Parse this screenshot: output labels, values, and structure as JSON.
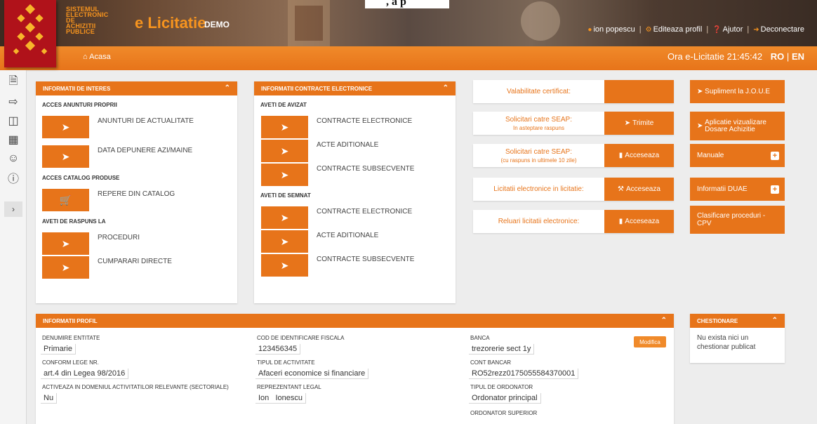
{
  "header": {
    "page_title_fragment": ", a p",
    "brand_lines": [
      "SISTEMUL",
      "ELECTRONIC DE",
      "ACHIZITII",
      "PUBLICE"
    ],
    "app_name": "e Licitatie",
    "env_badge": "DEMO",
    "user_name": "ion popescu",
    "edit_profile": "Editeaza profil",
    "help": "Ajutor",
    "logout": "Deconectare",
    "home": "Acasa",
    "clock_label": "Ora e-Licitatie",
    "clock_time": "21:45:42",
    "lang_ro": "RO",
    "lang_sep": "|",
    "lang_en": "EN"
  },
  "sidebar": {
    "icons": [
      "document-icon",
      "export-icon",
      "stack-icon",
      "catalog-icon",
      "user-icon",
      "alert-icon"
    ],
    "toggle": "›"
  },
  "info_interes": {
    "title": "INFORMATII DE INTERES",
    "s1": "ACCES ANUNTURI PROPRII",
    "i1": "ANUNTURI DE ACTUALITATE",
    "i2": "DATA DEPUNERE AZI/MAINE",
    "s2": "ACCES CATALOG PRODUSE",
    "i3": "REPERE DIN CATALOG",
    "s3": "AVETI DE RASPUNS LA",
    "i4": "PROCEDURI",
    "i5": "CUMPARARI DIRECTE"
  },
  "contracte": {
    "title": "INFORMATII CONTRACTE ELECTRONICE",
    "s1": "AVETI DE AVIZAT",
    "a1": "CONTRACTE ELECTRONICE",
    "a2": "ACTE ADITIONALE",
    "a3": "CONTRACTE SUBSECVENTE",
    "s2": "AVETI DE SEMNAT",
    "b1": "CONTRACTE ELECTRONICE",
    "b2": "ACTE ADITIONALE",
    "b3": "CONTRACTE SUBSECVENTE"
  },
  "widgets": {
    "w1": "Valabilitate certificat:",
    "w2": "Solicitari catre SEAP:",
    "w2s": "In asteptare raspuns",
    "w2b": "Trimite",
    "w3": "Solicitari catre SEAP:",
    "w3s": "(cu raspuns in ultimele 10 zile)",
    "w3b": "Acceseaza",
    "w4": "Licitatii electronice in licitatie:",
    "w4b": "Acceseaza",
    "w5": "Reluari licitatii electronice:",
    "w5b": "Acceseaza"
  },
  "links": {
    "l1": "Supliment la J.O.U.E",
    "l2": "Aplicatie vizualizare Dosare Achizitie",
    "l3": "Manuale",
    "l4": "Informatii DUAE",
    "l5": "Clasificare proceduri - CPV"
  },
  "profil": {
    "title": "INFORMATII PROFIL",
    "c1l1": "DENUMIRE ENTITATE",
    "c1v1": "Primarie",
    "c1l2": "CONFORM LEGE NR.",
    "c1v2": "art.4 din Legea 98/2016",
    "c1l3": "ACTIVEAZA IN DOMENIUL ACTIVITATILOR RELEVANTE (SECTORIALE)",
    "c1v3": "Nu",
    "c2l1": "COD DE IDENTIFICARE FISCALA",
    "c2v1": "123456345",
    "c2l2": "TIPUL DE ACTIVITATE",
    "c2v2": "Afaceri economice si financiare",
    "c2l3": "REPREZENTANT LEGAL",
    "c2v3": "Ion   Ionescu",
    "c3l1": "BANCA",
    "c3v1": "trezorerie sect 1y",
    "c3l2": "CONT BANCAR",
    "c3v2": "RO52rezz0175055584370001",
    "c3l3": "TIPUL DE ORDONATOR",
    "c3v3": "Ordonator principal",
    "c3l4": "ORDONATOR SUPERIOR",
    "modifica": "Modifica"
  },
  "chestionare": {
    "title": "CHESTIONARE",
    "text": "Nu exista nici un chestionar publicat"
  }
}
